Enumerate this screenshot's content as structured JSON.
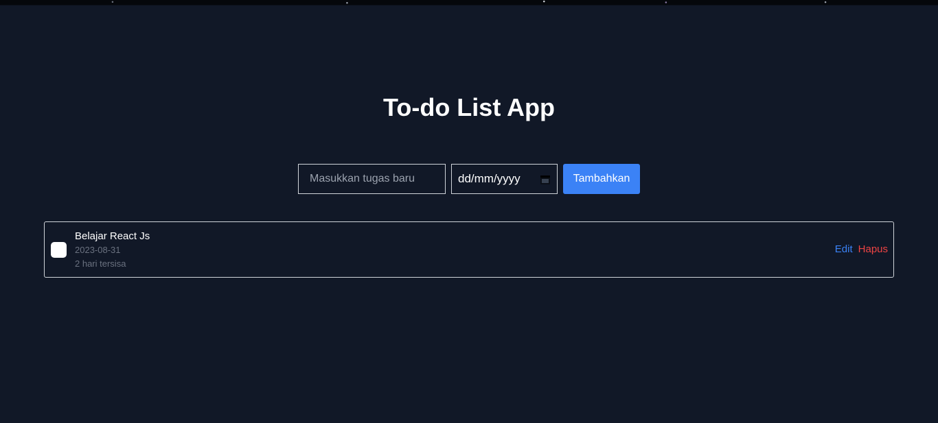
{
  "app": {
    "title": "To-do List App"
  },
  "form": {
    "task_placeholder": "Masukkan tugas baru",
    "task_value": "",
    "date_placeholder": "dd/mm/yyyy",
    "date_icon": "calendar-icon",
    "add_label": "Tambahkan"
  },
  "todos": [
    {
      "name": "Belajar React Js",
      "date": "2023-08-31",
      "remaining": "2 hari tersisa",
      "completed": false,
      "edit_label": "Edit",
      "delete_label": "Hapus"
    }
  ],
  "colors": {
    "background": "#111827",
    "accent": "#3b82f6",
    "danger": "#ef4444",
    "muted": "#6b7280"
  }
}
